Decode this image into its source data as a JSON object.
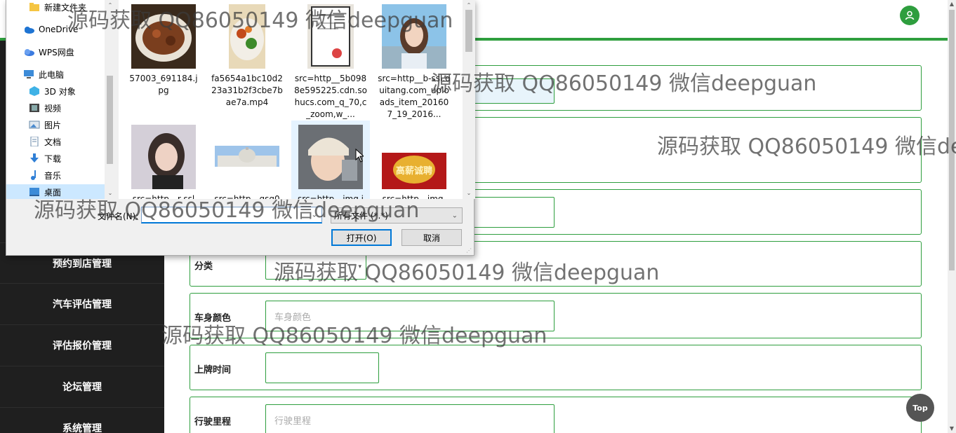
{
  "sidebar": {
    "items": [
      {
        "label": "预约到店管理"
      },
      {
        "label": "汽车评估管理"
      },
      {
        "label": "评估报价管理"
      },
      {
        "label": "论坛管理"
      },
      {
        "label": "系统管理"
      }
    ]
  },
  "form": {
    "category": {
      "label": "分类"
    },
    "color": {
      "label": "车身颜色",
      "placeholder": "车身颜色"
    },
    "plate_date": {
      "label": "上牌时间"
    },
    "mileage": {
      "label": "行驶里程",
      "placeholder": "行驶里程"
    }
  },
  "top_button": {
    "label": "Top"
  },
  "dialog": {
    "nav": [
      {
        "label": "新建文件夹",
        "icon": "folder-icon"
      },
      {
        "label": "OneDrive",
        "icon": "cloud-icon"
      },
      {
        "label": "WPS网盘",
        "icon": "cloud-icon"
      },
      {
        "label": "此电脑",
        "icon": "computer-icon"
      },
      {
        "label": "3D 对象",
        "icon": "cube-icon"
      },
      {
        "label": "视频",
        "icon": "video-icon"
      },
      {
        "label": "图片",
        "icon": "picture-icon"
      },
      {
        "label": "文档",
        "icon": "document-icon"
      },
      {
        "label": "下载",
        "icon": "download-icon"
      },
      {
        "label": "音乐",
        "icon": "music-icon"
      },
      {
        "label": "桌面",
        "icon": "desktop-icon"
      }
    ],
    "files": [
      {
        "name": "57003_691184.jpg",
        "thumb": "food-dish"
      },
      {
        "name": "fa5654a1bc10d223a31b2f3cbe7bae7a.mp4",
        "thumb": "food-dish"
      },
      {
        "name": "src=http__5b0988e595225.cdn.sohucs.com_q_70,c_zoom,w_...",
        "thumb": "certificate"
      },
      {
        "name": "src=http__b-ssl.duitang.com_uploads_item_201607_19_2016...",
        "thumb": "portrait"
      },
      {
        "name": "src=http__r-ssl",
        "thumb": "portrait"
      },
      {
        "name": "src=http__qsg0",
        "thumb": "building"
      },
      {
        "name": "src=http__img.i",
        "thumb": "portrait"
      },
      {
        "name": "src=http__img.",
        "thumb": "poster",
        "poster_text": "高薪诚聘"
      }
    ],
    "filename_label": "文件名(N):",
    "filename_value": "",
    "filetype": "所有文件 (*.*)",
    "open_label": "打开(O)",
    "cancel_label": "取消"
  },
  "watermarks": [
    "源码获取 QQ86050149 微信deepguan",
    "源码获取 QQ86050149 微信deepguan",
    "源码获取 QQ86050149 微信de",
    "源码获取 QQ86050149 微信deepguan",
    "源码获取 QQ86050149 微信deepguan",
    "源码获取 QQ86050149 微信deepguan"
  ],
  "colors": {
    "accent": "#2e9e3e",
    "sidebar_bg": "#1f1f1f",
    "dialog_bg": "#f0f0f0",
    "focus_blue": "#0078d7"
  }
}
